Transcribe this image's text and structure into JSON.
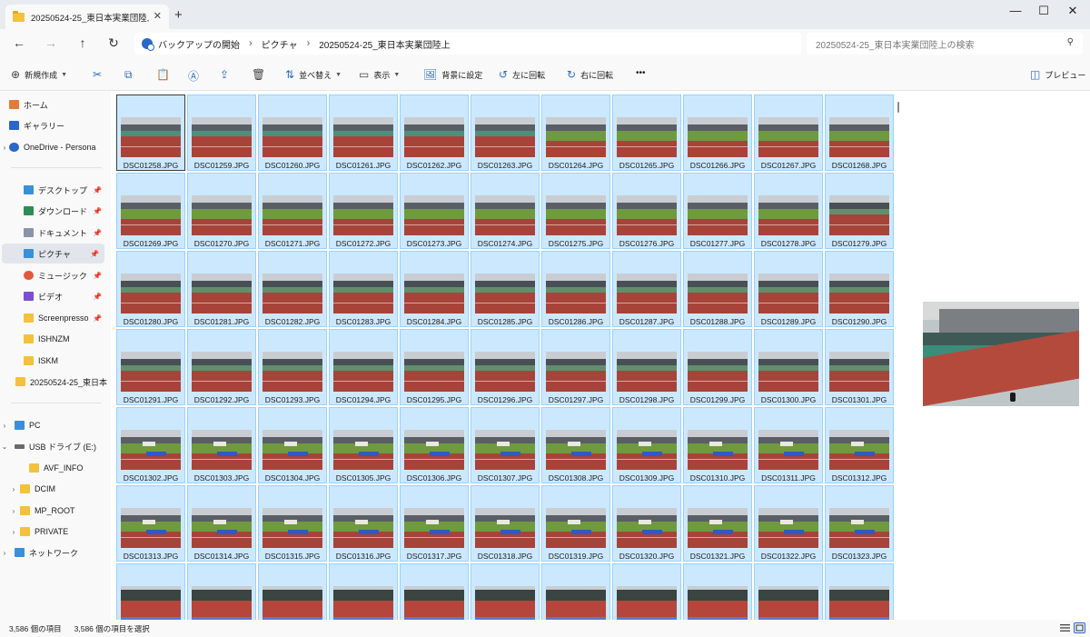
{
  "window": {
    "tab_title": "20250524-25_東日本実業団陸上",
    "tab_close": "✕",
    "new_tab": "+",
    "minimize": "—",
    "maximize": "☐",
    "close": "✕"
  },
  "address": {
    "crumbs": [
      "バックアップの開始",
      "ピクチャ",
      "20250524-25_東日本実業団陸上"
    ],
    "search_placeholder": "20250524-25_東日本実業団陸上の検索"
  },
  "toolbar": {
    "new": "新規作成",
    "sort": "並べ替え",
    "view": "表示",
    "set_background": "背景に設定",
    "rotate_left": "左に回転",
    "rotate_right": "右に回転",
    "more": "•••",
    "preview": "プレビュー"
  },
  "sidebar": {
    "items": [
      {
        "label": "ホーム",
        "icon": "home-icon",
        "color": "#e07b39"
      },
      {
        "label": "ギャラリー",
        "icon": "gallery-icon",
        "color": "#2b66c9"
      },
      {
        "label": "OneDrive - Persona",
        "icon": "onedrive-icon",
        "color": "#2b66c9"
      },
      {
        "label": "デスクトップ",
        "icon": "desktop-icon",
        "color": "#3b8fd6"
      },
      {
        "label": "ダウンロード",
        "icon": "download-icon",
        "color": "#2e8b57"
      },
      {
        "label": "ドキュメント",
        "icon": "document-icon",
        "color": "#8a94a6"
      },
      {
        "label": "ピクチャ",
        "icon": "pictures-icon",
        "color": "#3b8fd6"
      },
      {
        "label": "ミュージック",
        "icon": "music-icon",
        "color": "#e0593a"
      },
      {
        "label": "ビデオ",
        "icon": "video-icon",
        "color": "#7a4fd1"
      },
      {
        "label": "Screenpresso",
        "icon": "folder-icon",
        "color": "#f3c13a"
      },
      {
        "label": "ISHNZM",
        "icon": "folder-icon",
        "color": "#f3c13a"
      },
      {
        "label": "ISKM",
        "icon": "folder-icon",
        "color": "#f3c13a"
      },
      {
        "label": "20250524-25_東日本",
        "icon": "folder-icon",
        "color": "#f3c13a"
      },
      {
        "label": "PC",
        "icon": "pc-icon",
        "color": "#3b8fd6"
      },
      {
        "label": "USB ドライブ (E:)",
        "icon": "usb-drive-icon",
        "color": "#6a6a6a"
      },
      {
        "label": "AVF_INFO",
        "icon": "folder-icon",
        "color": "#f3c13a"
      },
      {
        "label": "DCIM",
        "icon": "folder-icon",
        "color": "#f3c13a"
      },
      {
        "label": "MP_ROOT",
        "icon": "folder-icon",
        "color": "#f3c13a"
      },
      {
        "label": "PRIVATE",
        "icon": "folder-icon",
        "color": "#f3c13a"
      },
      {
        "label": "ネットワーク",
        "icon": "network-icon",
        "color": "#3b8fd6"
      }
    ]
  },
  "files": [
    "DSC01258.JPG",
    "DSC01259.JPG",
    "DSC01260.JPG",
    "DSC01261.JPG",
    "DSC01262.JPG",
    "DSC01263.JPG",
    "DSC01264.JPG",
    "DSC01265.JPG",
    "DSC01266.JPG",
    "DSC01267.JPG",
    "DSC01268.JPG",
    "DSC01269.JPG",
    "DSC01270.JPG",
    "DSC01271.JPG",
    "DSC01272.JPG",
    "DSC01273.JPG",
    "DSC01274.JPG",
    "DSC01275.JPG",
    "DSC01276.JPG",
    "DSC01277.JPG",
    "DSC01278.JPG",
    "DSC01279.JPG",
    "DSC01280.JPG",
    "DSC01281.JPG",
    "DSC01282.JPG",
    "DSC01283.JPG",
    "DSC01284.JPG",
    "DSC01285.JPG",
    "DSC01286.JPG",
    "DSC01287.JPG",
    "DSC01288.JPG",
    "DSC01289.JPG",
    "DSC01290.JPG",
    "DSC01291.JPG",
    "DSC01292.JPG",
    "DSC01293.JPG",
    "DSC01294.JPG",
    "DSC01295.JPG",
    "DSC01296.JPG",
    "DSC01297.JPG",
    "DSC01298.JPG",
    "DSC01299.JPG",
    "DSC01300.JPG",
    "DSC01301.JPG",
    "DSC01302.JPG",
    "DSC01303.JPG",
    "DSC01304.JPG",
    "DSC01305.JPG",
    "DSC01306.JPG",
    "DSC01307.JPG",
    "DSC01308.JPG",
    "DSC01309.JPG",
    "DSC01310.JPG",
    "DSC01311.JPG",
    "DSC01312.JPG",
    "DSC01313.JPG",
    "DSC01314.JPG",
    "DSC01315.JPG",
    "DSC01316.JPG",
    "DSC01317.JPG",
    "DSC01318.JPG",
    "DSC01319.JPG",
    "DSC01320.JPG",
    "DSC01321.JPG",
    "DSC01322.JPG",
    "DSC01323.JPG"
  ],
  "status": {
    "item_count": "3,586 個の項目",
    "selected_count": "3,586 個の項目を選択"
  },
  "colors": {
    "selection_fill": "#cce8ff",
    "selection_border": "#99d1ff",
    "accent": "#2b66c9"
  }
}
